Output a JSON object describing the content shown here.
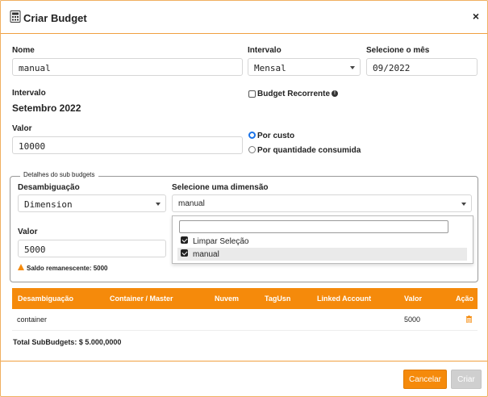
{
  "header": {
    "title": "Criar Budget",
    "close": "×"
  },
  "form": {
    "nome_label": "Nome",
    "nome_value": "manual",
    "intervalo_label": "Intervalo",
    "intervalo_value": "Mensal",
    "mes_label": "Selecione o mês",
    "mes_value": "09/2022",
    "intervalo2_label": "Intervalo",
    "intervalo2_value": "Setembro 2022",
    "recorrente_label": "Budget Recorrente",
    "valor_label": "Valor",
    "valor_value": "10000",
    "radio_custo": "Por custo",
    "radio_quantidade": "Por quantidade consumida"
  },
  "sub": {
    "legend": "Detalhes do sub budgets",
    "desamb_label": "Desambiguação",
    "desamb_value": "Dimension",
    "dimensao_label": "Selecione uma dimensão",
    "dimensao_value": "manual",
    "valor_label": "Valor",
    "valor_value": "5000",
    "saldo_text": "Saldo remanescente: 5000",
    "dropdown": {
      "items": [
        "Limpar Seleção",
        "manual"
      ]
    }
  },
  "table": {
    "headers": [
      "Desambiguação",
      "Container / Master",
      "Nuvem",
      "TagUsn",
      "Linked Account",
      "Valor",
      "Ação"
    ],
    "rows": [
      {
        "desamb": "container",
        "valor": "5000"
      }
    ]
  },
  "total": "Total SubBudgets: $ 5.000,0000",
  "buttons": {
    "cancel": "Cancelar",
    "create": "Criar"
  },
  "colors": {
    "accent": "#f58a0b",
    "radio": "#1a73e8"
  }
}
